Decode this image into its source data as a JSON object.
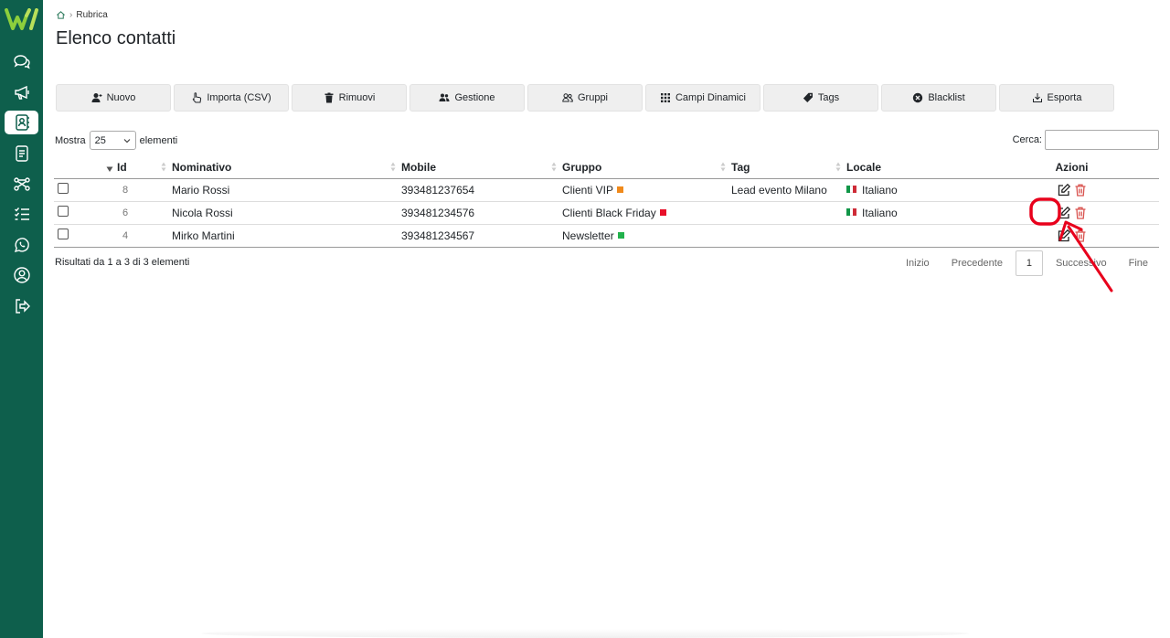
{
  "breadcrumb": {
    "current": "Rubrica"
  },
  "page": {
    "title": "Elenco contatti"
  },
  "toolbar": {
    "nuovo": "Nuovo",
    "importa": "Importa (CSV)",
    "rimuovi": "Rimuovi",
    "gestione": "Gestione",
    "gruppi": "Gruppi",
    "campi": "Campi Dinamici",
    "tags": "Tags",
    "blacklist": "Blacklist",
    "esporta": "Esporta"
  },
  "length": {
    "prefix": "Mostra",
    "value": "25",
    "suffix": "elementi"
  },
  "search": {
    "label": "Cerca:",
    "value": ""
  },
  "table": {
    "headers": {
      "id": "Id",
      "nominativo": "Nominativo",
      "mobile": "Mobile",
      "gruppo": "Gruppo",
      "tag": "Tag",
      "locale": "Locale",
      "azioni": "Azioni"
    },
    "rows": [
      {
        "id": "8",
        "nominativo": "Mario Rossi",
        "mobile": "393481237654",
        "gruppo": "Clienti VIP",
        "gruppo_color": "#f08a1c",
        "tag": "Lead evento Milano",
        "locale": "Italiano"
      },
      {
        "id": "6",
        "nominativo": "Nicola Rossi",
        "mobile": "393481234576",
        "gruppo": "Clienti Black Friday",
        "gruppo_color": "#e8102a",
        "tag": "",
        "locale": "Italiano"
      },
      {
        "id": "4",
        "nominativo": "Mirko Martini",
        "mobile": "393481234567",
        "gruppo": "Newsletter",
        "gruppo_color": "#22b24c",
        "tag": "",
        "locale": ""
      }
    ]
  },
  "info": "Risultati da 1 a 3 di 3 elementi",
  "pager": {
    "first": "Inizio",
    "prev": "Precedente",
    "current": "1",
    "next": "Successivo",
    "last": "Fine"
  },
  "colors": {
    "sidebar": "#0e5f4c",
    "annotation": "#e8001c",
    "delete": "#d9534f"
  }
}
